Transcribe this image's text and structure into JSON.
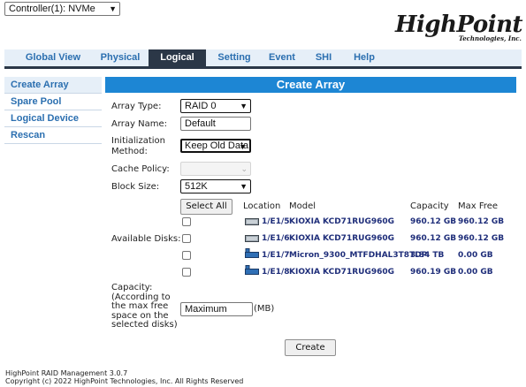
{
  "controller": {
    "selected": "Controller(1): NVMe"
  },
  "logo": {
    "brand": "HighPoint",
    "tagline": "Technologies, Inc."
  },
  "nav": {
    "tabs": [
      {
        "label": "Global View",
        "active": false
      },
      {
        "label": "Physical",
        "active": false
      },
      {
        "label": "Logical",
        "active": true
      },
      {
        "label": "Setting",
        "active": false
      },
      {
        "label": "Event",
        "active": false
      },
      {
        "label": "SHI",
        "active": false
      },
      {
        "label": "Help",
        "active": false
      }
    ]
  },
  "sidebar": {
    "items": [
      {
        "label": "Create Array",
        "active": true
      },
      {
        "label": "Spare Pool",
        "active": false
      },
      {
        "label": "Logical Device",
        "active": false
      },
      {
        "label": "Rescan",
        "active": false
      }
    ]
  },
  "panel": {
    "title": "Create Array"
  },
  "form": {
    "array_type": {
      "label": "Array Type:",
      "value": "RAID 0"
    },
    "array_name": {
      "label": "Array Name:",
      "value": "Default"
    },
    "init_method": {
      "label_line1": "Initialization",
      "label_line2": "Method:",
      "value": "Keep Old Data"
    },
    "cache_policy": {
      "label": "Cache Policy:",
      "value": ""
    },
    "block_size": {
      "label": "Block Size:",
      "value": "512K"
    },
    "available_disks": {
      "label": "Available Disks:"
    },
    "capacity": {
      "label_lines": [
        "Capacity:",
        "(According to",
        "the max free",
        "space on the",
        "selected disks)"
      ],
      "value": "Maximum",
      "unit": "(MB)"
    }
  },
  "disks": {
    "select_all_label": "Select All",
    "headers": {
      "location": "Location",
      "model": "Model",
      "capacity": "Capacity",
      "max_free": "Max Free"
    },
    "rows": [
      {
        "location": "1/E1/5",
        "model": "KIOXIA KCD71RUG960G",
        "capacity": "960.12 GB",
        "max_free": "960.12 GB",
        "icon": "ssd-drive-icon"
      },
      {
        "location": "1/E1/6",
        "model": "KIOXIA KCD71RUG960G",
        "capacity": "960.12 GB",
        "max_free": "960.12 GB",
        "icon": "ssd-drive-icon"
      },
      {
        "location": "1/E1/7",
        "model": "Micron_9300_MTFDHAL3T8TDP",
        "capacity": "3.84 TB",
        "max_free": "0.00 GB",
        "icon": "disk-drive-icon"
      },
      {
        "location": "1/E1/8",
        "model": "KIOXIA KCD71RUG960G",
        "capacity": "960.19 GB",
        "max_free": "0.00 GB",
        "icon": "disk-drive-icon"
      }
    ]
  },
  "actions": {
    "create_label": "Create"
  },
  "footer": {
    "line1": "HighPoint RAID Management 3.0.7",
    "line2": "Copyright (c) 2022 HighPoint Technologies, Inc. All Rights Reserved"
  },
  "colors": {
    "nav_bg": "#e6eff8",
    "nav_active": "#2b3747",
    "link_blue": "#2b6fb0",
    "panel_title_bg": "#1d86d4",
    "disk_text": "#1f2e7a"
  }
}
